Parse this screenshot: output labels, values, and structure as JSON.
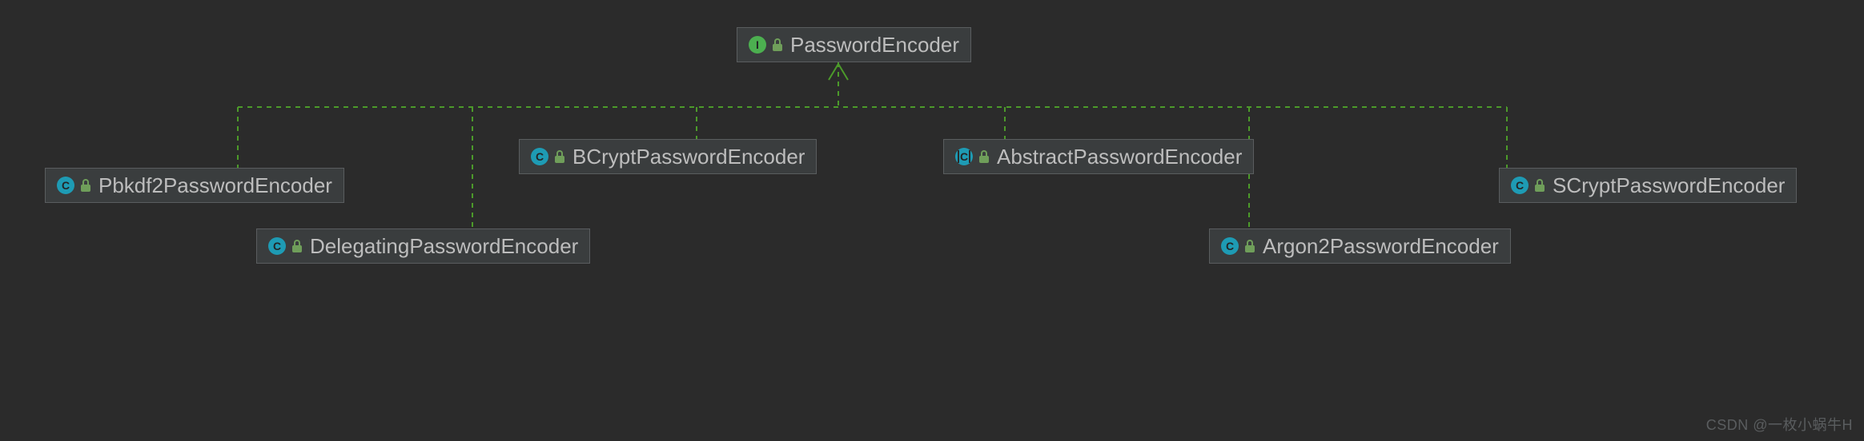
{
  "colors": {
    "background": "#2b2b2b",
    "node_bg": "#3a3d3e",
    "node_border": "#5a5d5f",
    "node_text": "#bdbdbd",
    "connector": "#4c9a2a",
    "interface_icon": "#4caf50",
    "class_icon": "#1e9bb4",
    "lock_icon": "#6f9e5a",
    "watermark": "#5a5d5f"
  },
  "root": {
    "label": "PasswordEncoder",
    "type": "interface",
    "icon_letter": "I"
  },
  "children": [
    {
      "id": "pbkdf2",
      "label": "Pbkdf2PasswordEncoder",
      "type": "class",
      "icon_letter": "C"
    },
    {
      "id": "delegate",
      "label": "DelegatingPasswordEncoder",
      "type": "class",
      "icon_letter": "C"
    },
    {
      "id": "bcrypt",
      "label": "BCryptPasswordEncoder",
      "type": "class",
      "icon_letter": "C"
    },
    {
      "id": "abstract",
      "label": "AbstractPasswordEncoder",
      "type": "abstract",
      "icon_letter": "C"
    },
    {
      "id": "argon2",
      "label": "Argon2PasswordEncoder",
      "type": "class",
      "icon_letter": "C"
    },
    {
      "id": "scrypt",
      "label": "SCryptPasswordEncoder",
      "type": "class",
      "icon_letter": "C"
    }
  ],
  "watermark": "CSDN @一枚小蜗牛H"
}
